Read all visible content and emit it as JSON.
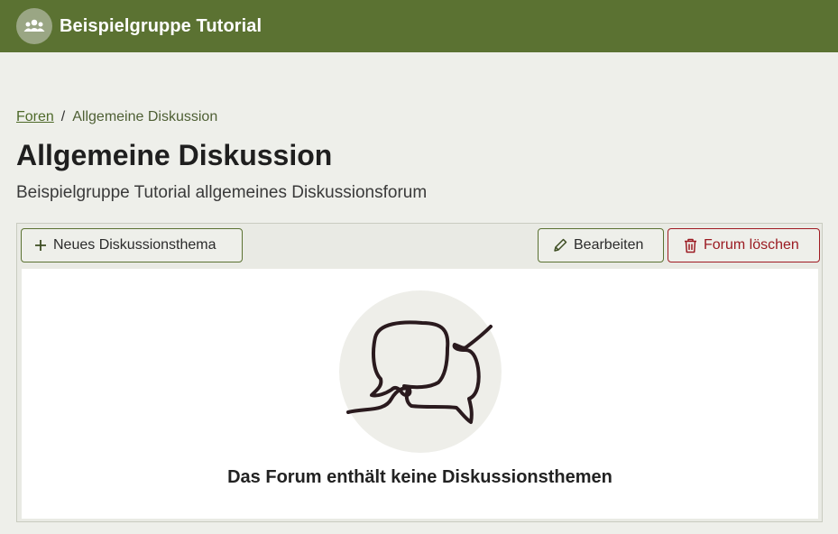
{
  "header": {
    "group_name": "Beispielgruppe Tutorial",
    "avatar_icon": "group-icon"
  },
  "breadcrumb": {
    "parent": "Foren",
    "separator": "/",
    "current": "Allgemeine Diskussion"
  },
  "page": {
    "title": "Allgemeine Diskussion",
    "subtitle": "Beispielgruppe Tutorial allgemeines Diskussionsforum"
  },
  "toolbar": {
    "new_topic_label": "Neues Diskussionsthema",
    "new_topic_icon": "plus-icon",
    "edit_label": "Bearbeiten",
    "edit_icon": "pencil-icon",
    "delete_label": "Forum löschen",
    "delete_icon": "trash-icon"
  },
  "empty_state": {
    "illustration": "speech-bubbles-icon",
    "message": "Das Forum enthält keine Diskussionsthemen"
  },
  "colors": {
    "header_bg": "#5b7232",
    "page_bg": "#eeefea",
    "danger": "#9b1b22"
  }
}
